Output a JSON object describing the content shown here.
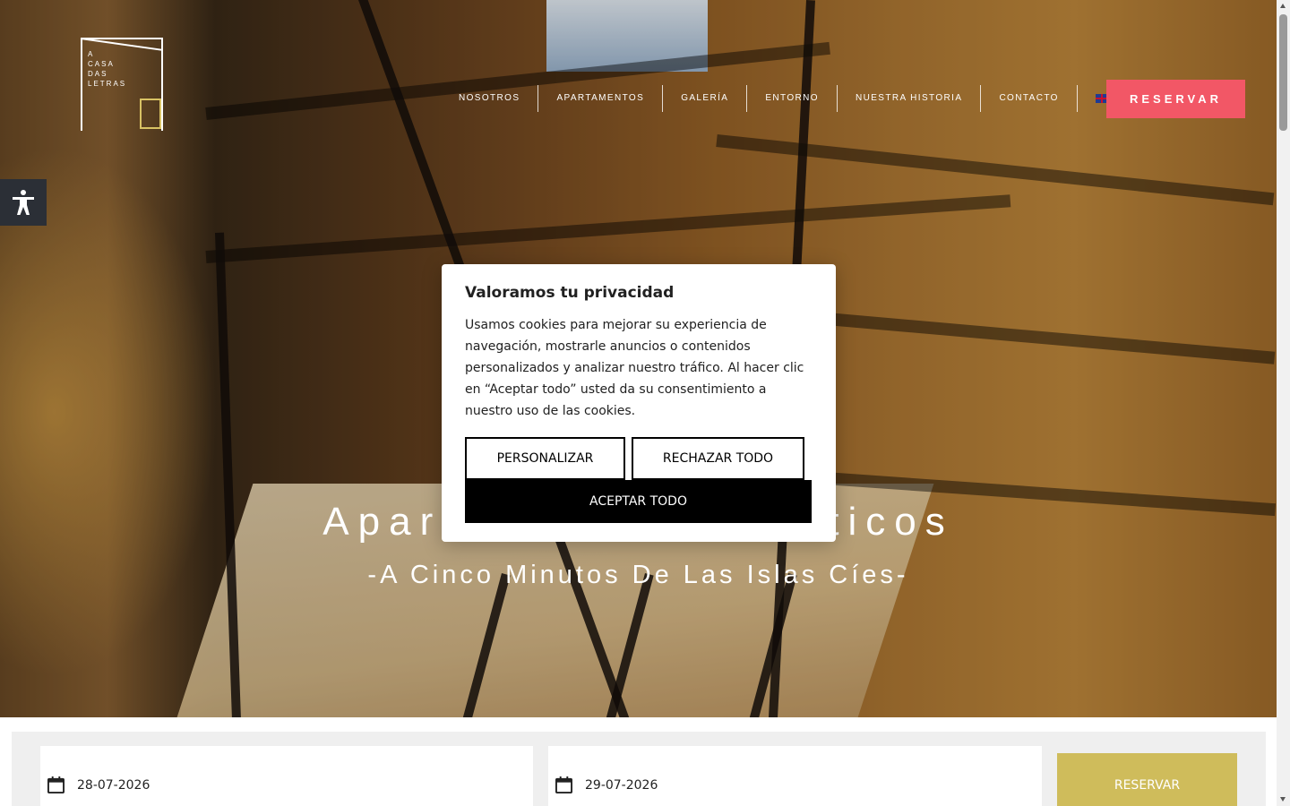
{
  "logo": {
    "lines": [
      "A",
      "CASA",
      "DAS",
      "LETRAS"
    ]
  },
  "nav": {
    "items": [
      "NOSOTROS",
      "APARTAMENTOS",
      "GALERÍA",
      "ENTORNO",
      "NUESTRA HISTORIA",
      "CONTACTO"
    ],
    "language_icon": "uk-flag-icon"
  },
  "header": {
    "reserve_label": "RESERVAR"
  },
  "hero": {
    "title": "Apartamentos Turísticos",
    "subtitle": "-A Cinco Minutos De Las Islas Cíes-"
  },
  "cookie": {
    "title": "Valoramos tu privacidad",
    "text": "Usamos cookies para mejorar su experiencia de navegación, mostrarle anuncios o contenidos personalizados y analizar nuestro tráfico. Al hacer clic en “Aceptar todo” usted da su consentimiento a nuestro uso de las cookies.",
    "customize_label": "PERSONALIZAR",
    "reject_label": "RECHAZAR TODO",
    "accept_label": "ACEPTAR TODO"
  },
  "booking": {
    "checkin": "28-07-2026",
    "checkout": "29-07-2026",
    "reserve_label": "RESERVAR"
  },
  "colors": {
    "reserve_top": "#f25766",
    "reserve_bottom": "#cfbc5b",
    "accessibility_bg": "#2b2f36"
  }
}
